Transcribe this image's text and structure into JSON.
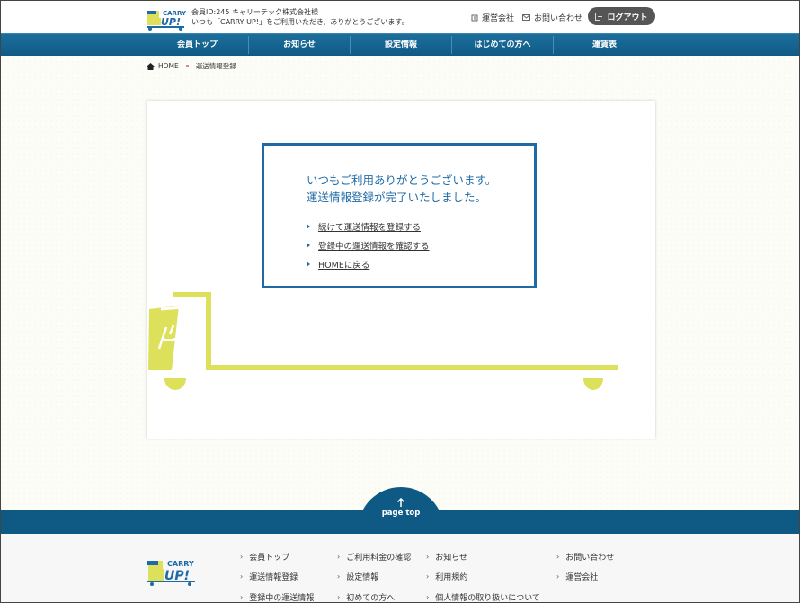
{
  "header": {
    "member_line": "会員ID:245 キャリーテック株式会社様",
    "welcome_line": "いつも「CARRY UP!」をご利用いただき、ありがとうございます。",
    "company_link": "運営会社",
    "contact_link": "お問い合わせ",
    "logout_label": "ログアウト",
    "logo_text_top": "CARRY",
    "logo_text_bottom": "UP!"
  },
  "nav": {
    "items": [
      "会員トップ",
      "お知らせ",
      "設定情報",
      "はじめての方へ",
      "運賃表"
    ]
  },
  "breadcrumb": {
    "home": "HOME",
    "current": "運送情報登録"
  },
  "message": {
    "line1": "いつもご利用ありがとうございます。",
    "line2": "運送情報登録が完了いたしました。",
    "links": [
      "続けて運送情報を登録する",
      "登録中の運送情報を確認する",
      "HOMEに戻る"
    ]
  },
  "pagetop": {
    "label": "page top"
  },
  "footer": {
    "col1": [
      "会員トップ",
      "運送情報登録",
      "登録中の運送情報"
    ],
    "col2": [
      "ご利用料金の確認",
      "設定情報",
      "初めての方へ"
    ],
    "col3": [
      "お知らせ",
      "利用規約",
      "個人情報の取り扱いについて"
    ],
    "col4": [
      "お問い合わせ",
      "運営会社"
    ]
  },
  "colors": {
    "brand_blue": "#0f5a85",
    "accent_blue": "#1d6aa6",
    "truck_yellow": "#dde05a",
    "logout_bg": "#555555"
  }
}
